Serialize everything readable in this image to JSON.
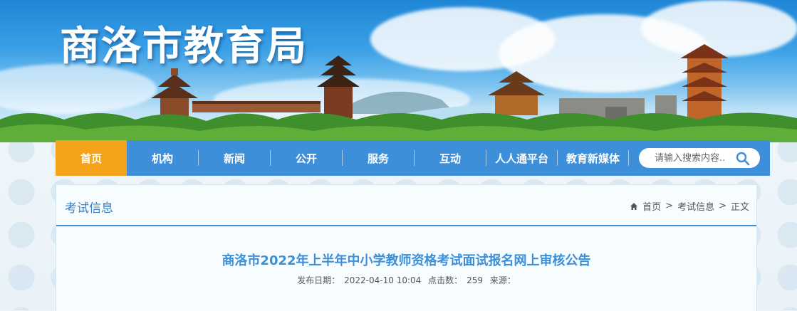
{
  "site": {
    "title": "商洛市教育局"
  },
  "nav": {
    "items": [
      {
        "label": "首页",
        "active": true
      },
      {
        "label": "机构"
      },
      {
        "label": "新闻"
      },
      {
        "label": "公开"
      },
      {
        "label": "服务"
      },
      {
        "label": "互动"
      },
      {
        "label": "人人通平台"
      },
      {
        "label": "教育新媒体"
      }
    ],
    "search_placeholder": "请输入搜索内容..",
    "active_color": "#f5a31a",
    "bar_color": "#3d8fd9"
  },
  "section": {
    "title": "考试信息"
  },
  "breadcrumb": {
    "home": "首页",
    "sep": ">",
    "level1": "考试信息",
    "level2": "正文"
  },
  "article": {
    "title": "商洛市2022年上半年中小学教师资格考试面试报名网上审核公告",
    "date_label": "发布日期：",
    "date": "2022-04-10 10:04",
    "hits_label": "点击数：",
    "hits": "259",
    "source_label": "来源："
  }
}
